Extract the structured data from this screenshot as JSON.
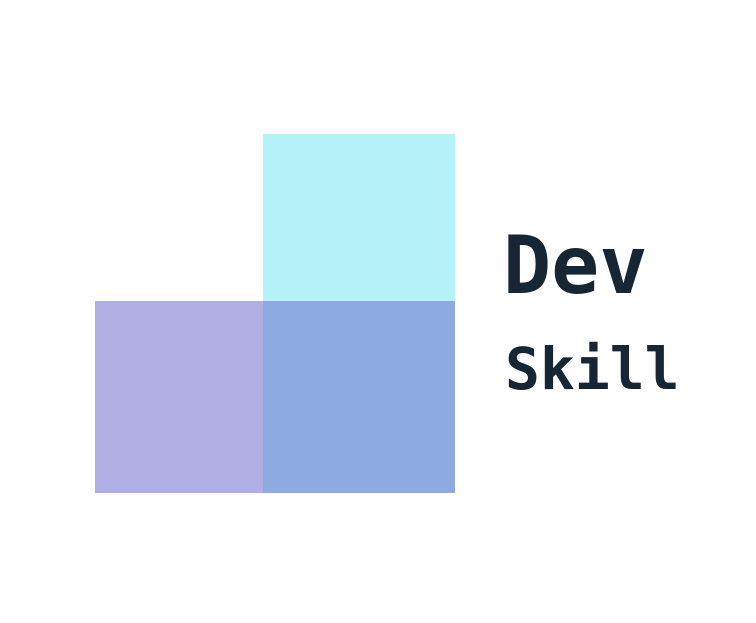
{
  "logo": {
    "title_line1": "Dev",
    "title_line2": "Skill",
    "colors": {
      "top_square": "#b6f2f9",
      "left_square": "#b0aee2",
      "right_square": "#8eaae2",
      "text": "#172635"
    }
  }
}
